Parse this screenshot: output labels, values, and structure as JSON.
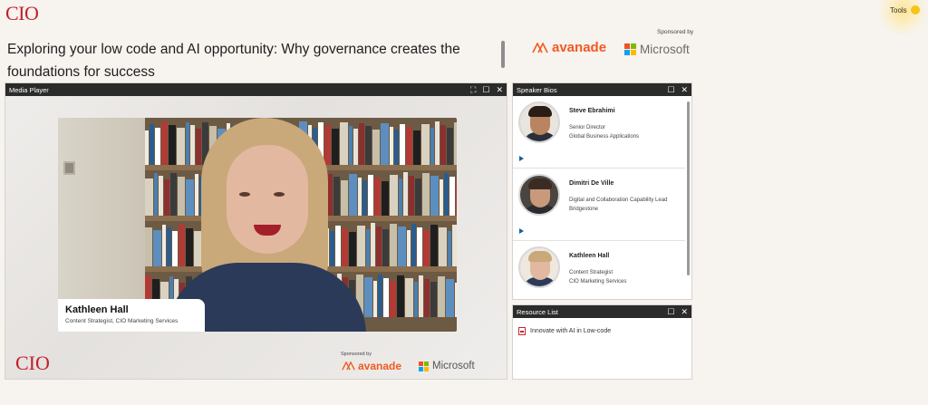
{
  "brand": {
    "logo_text": "CIO"
  },
  "tools": {
    "label": "Tools"
  },
  "event": {
    "title": "Exploring your low code and AI opportunity: Why governance creates the foundations for success"
  },
  "sponsors": {
    "label": "Sponsored by",
    "avanade": "avanade",
    "microsoft": "Microsoft"
  },
  "media_player": {
    "title": "Media Player",
    "presenter": {
      "name": "Kathleen Hall",
      "role": "Content Strategist, CIO Marketing Services"
    },
    "overlay": {
      "logo_text": "CIO",
      "sponsored_label": "Sponsored by",
      "avanade": "avanade",
      "microsoft": "Microsoft"
    }
  },
  "speaker_bios": {
    "title": "Speaker Bios",
    "speakers": [
      {
        "name": "Steve Ebrahimi",
        "role": "Senior Director",
        "company": "Global Business Applications"
      },
      {
        "name": "Dimitri De Ville",
        "role": "Digital and Collaboration Capability Lead",
        "company": "Bridgestone"
      },
      {
        "name": "Kathleen Hall",
        "role": "Content Strategist",
        "company": "CIO Marketing Services"
      }
    ]
  },
  "resource_list": {
    "title": "Resource List",
    "items": [
      {
        "label": "Innovate with AI in Low-code"
      }
    ]
  },
  "colors": {
    "brand_red": "#c0202a",
    "avanade_orange": "#f15a22",
    "panel_header": "#2b2b2b",
    "tools_dot": "#f5c518"
  }
}
